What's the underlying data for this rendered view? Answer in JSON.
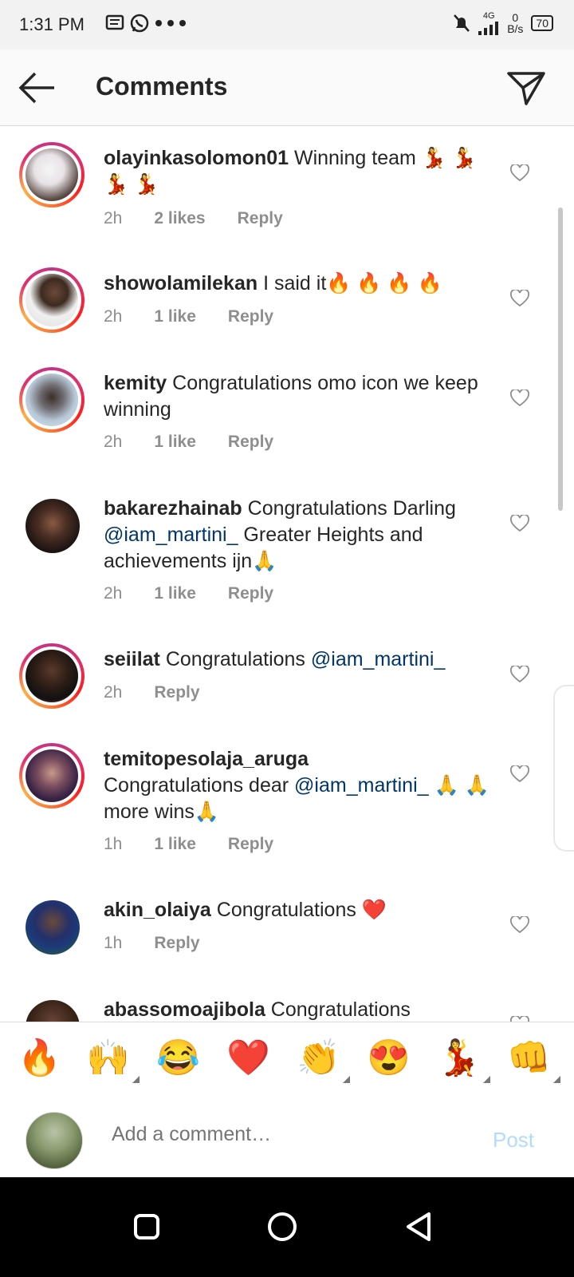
{
  "status_bar": {
    "time": "1:31 PM",
    "left_icons": [
      "message-icon",
      "whatsapp-icon",
      "more-dots-icon"
    ],
    "network": "4G",
    "speed_value": "0",
    "speed_unit": "B/s",
    "battery": "70"
  },
  "header": {
    "title": "Comments",
    "back_icon": "arrow-left-icon",
    "send_icon": "paper-plane-icon"
  },
  "comments": [
    {
      "username": "olayinkasolomon01",
      "text": " Winning team 💃 💃 💃 💃",
      "time": "2h",
      "likes": "2 likes",
      "reply": "Reply",
      "story_ring": true
    },
    {
      "username": "showolamilekan",
      "text": " I said it🔥 🔥 🔥 🔥",
      "time": "2h",
      "likes": "1 like",
      "reply": "Reply",
      "story_ring": true
    },
    {
      "username": "kemity",
      "text": " Congratulations omo icon we keep winning",
      "time": "2h",
      "likes": "1 like",
      "reply": "Reply",
      "story_ring": true
    },
    {
      "username": "bakarezhainab",
      "text_before": " Congratulations Darling ",
      "mention": "@iam_martini_",
      "text_after": "  Greater Heights and achievements ijn🙏",
      "time": "2h",
      "likes": "1 like",
      "reply": "Reply",
      "story_ring": false
    },
    {
      "username": "seiilat",
      "text_before": " Congratulations ",
      "mention": "@iam_martini_",
      "time": "2h",
      "reply": "Reply",
      "story_ring": true
    },
    {
      "username": "temitopesolaja_aruga",
      "text_before": "Congratulations dear ",
      "mention": "@iam_martini_",
      "text_after": " 🙏 🙏more wins🙏",
      "time": "1h",
      "likes": "1 like",
      "reply": "Reply",
      "story_ring": true
    },
    {
      "username": "akin_olaiya",
      "text": " Congratulations ❤️",
      "time": "1h",
      "reply": "Reply",
      "story_ring": false
    },
    {
      "username": "abassomoajibola",
      "text": " Congratulations",
      "story_ring": false
    }
  ],
  "quick_emojis": [
    "🔥",
    "🙌",
    "😂",
    "❤️",
    "👏",
    "😍",
    "💃",
    "👊"
  ],
  "comment_input": {
    "placeholder": "Add a comment…",
    "post_label": "Post"
  },
  "colors": {
    "mention": "#003569",
    "meta": "#8e8e8e",
    "post_disabled": "#b3dbff"
  }
}
